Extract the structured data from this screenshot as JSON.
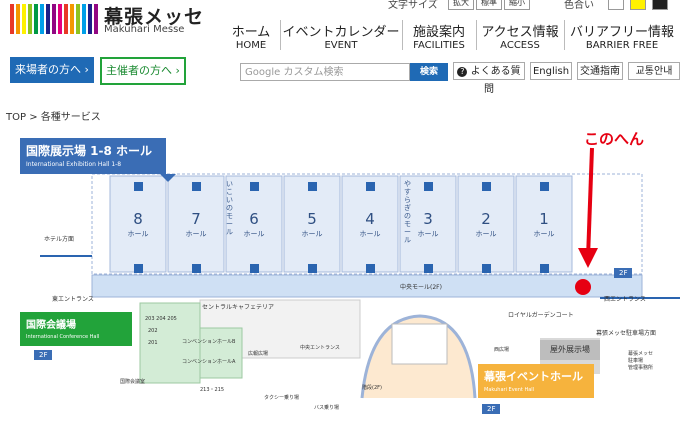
{
  "header": {
    "logo_jp": "幕張メッセ",
    "logo_en": "Makuhari Messe",
    "font_size_label": "文字サイズ",
    "font_size_buttons": [
      "拡大",
      "標準",
      "縮小"
    ],
    "color_label": "色合い",
    "logo_bar_colors": [
      "#e83828",
      "#f39800",
      "#fff100",
      "#8fc31f",
      "#009944",
      "#00a0e9",
      "#1d2088",
      "#920783",
      "#e4007f",
      "#e83828",
      "#f39800",
      "#8fc31f",
      "#00a0e9",
      "#1d2088",
      "#920783"
    ]
  },
  "nav": [
    {
      "jp": "ホーム",
      "en": "HOME"
    },
    {
      "jp": "イベントカレンダー",
      "en": "EVENT"
    },
    {
      "jp": "施設案内",
      "en": "FACILITIES"
    },
    {
      "jp": "アクセス情報",
      "en": "ACCESS"
    },
    {
      "jp": "バリアフリー情報",
      "en": "BARRIER FREE"
    }
  ],
  "buttons": {
    "visitor": "来場者の方へ ›",
    "organizer": "主催者の方へ ›",
    "search_placeholder": "Google カスタム検索",
    "search_button": "検索",
    "faq": "よくある質問",
    "english": "English",
    "traffic": "交通指南",
    "korean": "교통안내"
  },
  "breadcrumb": "TOP > 各種サービス",
  "map": {
    "hall_title": "国際展示場 1-8 ホール",
    "hall_title_en": "International Exhibition Hall 1-8",
    "halls": [
      "8",
      "7",
      "6",
      "5",
      "4",
      "3",
      "2",
      "1"
    ],
    "hall_label": "ホール",
    "mall_ikoi": "いこいのモール",
    "mall_yasuragi": "やすらぎのモール",
    "hotel": "ホテル方面",
    "east_entrance": "東エントランス",
    "west_entrance": "西エントランス",
    "central_mall": "中央モール(2F)",
    "cafeteria": "セントラルキャフェテリア",
    "royal_garden": "ロイヤルガーデンコート",
    "parking": "幕張メッセ駐車場方面",
    "parking2": "幕張メッセ\n駐車場\n管理事務所",
    "conf_title": "国際会議場",
    "conf_title_en": "International Conference Hall",
    "floor_2f": "2F",
    "rooms": [
      "203 204 205",
      "202",
      "201"
    ],
    "convention_a": "コンベンションホールB",
    "convention_b": "コンベンションホールA",
    "lounge": "広報広場",
    "conf_office": "国際会議室",
    "rooms2": "213・215",
    "central_entrance": "中央エントランス",
    "taxi": "タクシー乗り場",
    "bus": "バス乗り場",
    "ramp": "階段(2F)",
    "event_title": "幕張イベントホール",
    "event_title_en": "Makuhari Event Hall",
    "west_area": "西広場",
    "outdoor": "屋外展示場",
    "annotation": "このへん",
    "annotation_color": "#e60012"
  }
}
